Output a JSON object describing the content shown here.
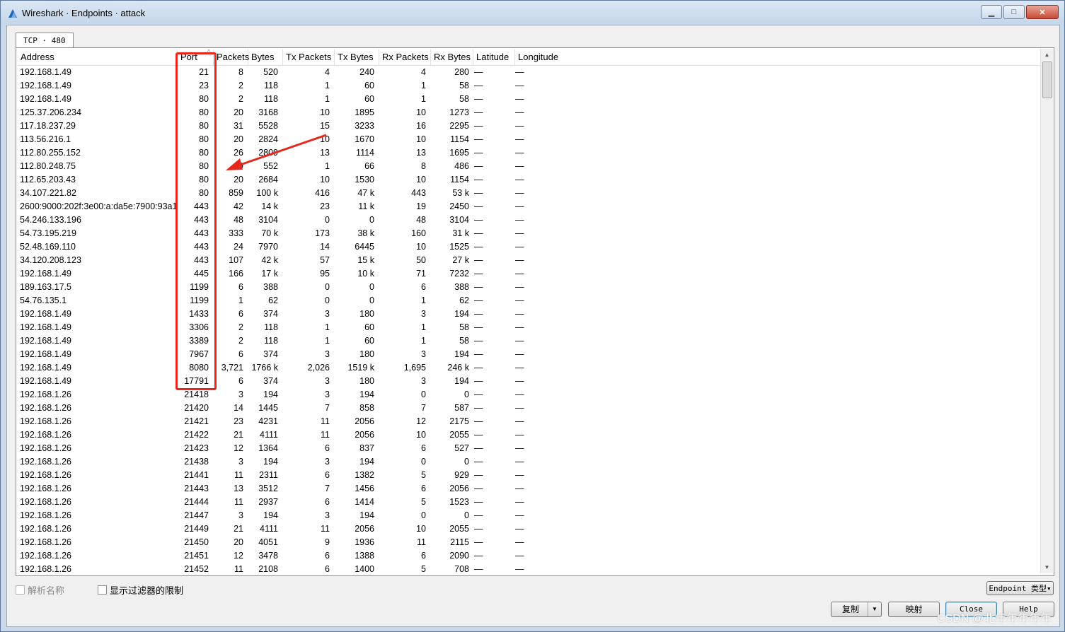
{
  "window": {
    "title": "Wireshark · Endpoints · attack",
    "minimize_glyph": "▁",
    "maximize_glyph": "□",
    "close_glyph": "✕"
  },
  "tab": {
    "label": "TCP · 480"
  },
  "columns": [
    "Address",
    "Port",
    "Packets",
    "Bytes",
    "Tx Packets",
    "Tx Bytes",
    "Rx Packets",
    "Rx Bytes",
    "Latitude",
    "Longitude"
  ],
  "rows": [
    [
      "192.168.1.49",
      "21",
      "8",
      "520",
      "4",
      "240",
      "4",
      "280",
      "—",
      "—"
    ],
    [
      "192.168.1.49",
      "23",
      "2",
      "118",
      "1",
      "60",
      "1",
      "58",
      "—",
      "—"
    ],
    [
      "192.168.1.49",
      "80",
      "2",
      "118",
      "1",
      "60",
      "1",
      "58",
      "—",
      "—"
    ],
    [
      "125.37.206.234",
      "80",
      "20",
      "3168",
      "10",
      "1895",
      "10",
      "1273",
      "—",
      "—"
    ],
    [
      "117.18.237.29",
      "80",
      "31",
      "5528",
      "15",
      "3233",
      "16",
      "2295",
      "—",
      "—"
    ],
    [
      "113.56.216.1",
      "80",
      "20",
      "2824",
      "10",
      "1670",
      "10",
      "1154",
      "—",
      "—"
    ],
    [
      "112.80.255.152",
      "80",
      "26",
      "2809",
      "13",
      "1114",
      "13",
      "1695",
      "—",
      "—"
    ],
    [
      "112.80.248.75",
      "80",
      "9",
      "552",
      "1",
      "66",
      "8",
      "486",
      "—",
      "—"
    ],
    [
      "112.65.203.43",
      "80",
      "20",
      "2684",
      "10",
      "1530",
      "10",
      "1154",
      "—",
      "—"
    ],
    [
      "34.107.221.82",
      "80",
      "859",
      "100 k",
      "416",
      "47 k",
      "443",
      "53 k",
      "—",
      "—"
    ],
    [
      "2600:9000:202f:3e00:a:da5e:7900:93a1",
      "443",
      "42",
      "14 k",
      "23",
      "11 k",
      "19",
      "2450",
      "—",
      "—"
    ],
    [
      "54.246.133.196",
      "443",
      "48",
      "3104",
      "0",
      "0",
      "48",
      "3104",
      "—",
      "—"
    ],
    [
      "54.73.195.219",
      "443",
      "333",
      "70 k",
      "173",
      "38 k",
      "160",
      "31 k",
      "—",
      "—"
    ],
    [
      "52.48.169.110",
      "443",
      "24",
      "7970",
      "14",
      "6445",
      "10",
      "1525",
      "—",
      "—"
    ],
    [
      "34.120.208.123",
      "443",
      "107",
      "42 k",
      "57",
      "15 k",
      "50",
      "27 k",
      "—",
      "—"
    ],
    [
      "192.168.1.49",
      "445",
      "166",
      "17 k",
      "95",
      "10 k",
      "71",
      "7232",
      "—",
      "—"
    ],
    [
      "189.163.17.5",
      "1199",
      "6",
      "388",
      "0",
      "0",
      "6",
      "388",
      "—",
      "—"
    ],
    [
      "54.76.135.1",
      "1199",
      "1",
      "62",
      "0",
      "0",
      "1",
      "62",
      "—",
      "—"
    ],
    [
      "192.168.1.49",
      "1433",
      "6",
      "374",
      "3",
      "180",
      "3",
      "194",
      "—",
      "—"
    ],
    [
      "192.168.1.49",
      "3306",
      "2",
      "118",
      "1",
      "60",
      "1",
      "58",
      "—",
      "—"
    ],
    [
      "192.168.1.49",
      "3389",
      "2",
      "118",
      "1",
      "60",
      "1",
      "58",
      "—",
      "—"
    ],
    [
      "192.168.1.49",
      "7967",
      "6",
      "374",
      "3",
      "180",
      "3",
      "194",
      "—",
      "—"
    ],
    [
      "192.168.1.49",
      "8080",
      "3,721",
      "1766 k",
      "2,026",
      "1519 k",
      "1,695",
      "246 k",
      "—",
      "—"
    ],
    [
      "192.168.1.49",
      "17791",
      "6",
      "374",
      "3",
      "180",
      "3",
      "194",
      "—",
      "—"
    ],
    [
      "192.168.1.26",
      "21418",
      "3",
      "194",
      "3",
      "194",
      "0",
      "0",
      "—",
      "—"
    ],
    [
      "192.168.1.26",
      "21420",
      "14",
      "1445",
      "7",
      "858",
      "7",
      "587",
      "—",
      "—"
    ],
    [
      "192.168.1.26",
      "21421",
      "23",
      "4231",
      "11",
      "2056",
      "12",
      "2175",
      "—",
      "—"
    ],
    [
      "192.168.1.26",
      "21422",
      "21",
      "4111",
      "11",
      "2056",
      "10",
      "2055",
      "—",
      "—"
    ],
    [
      "192.168.1.26",
      "21423",
      "12",
      "1364",
      "6",
      "837",
      "6",
      "527",
      "—",
      "—"
    ],
    [
      "192.168.1.26",
      "21438",
      "3",
      "194",
      "3",
      "194",
      "0",
      "0",
      "—",
      "—"
    ],
    [
      "192.168.1.26",
      "21441",
      "11",
      "2311",
      "6",
      "1382",
      "5",
      "929",
      "—",
      "—"
    ],
    [
      "192.168.1.26",
      "21443",
      "13",
      "3512",
      "7",
      "1456",
      "6",
      "2056",
      "—",
      "—"
    ],
    [
      "192.168.1.26",
      "21444",
      "11",
      "2937",
      "6",
      "1414",
      "5",
      "1523",
      "—",
      "—"
    ],
    [
      "192.168.1.26",
      "21447",
      "3",
      "194",
      "3",
      "194",
      "0",
      "0",
      "—",
      "—"
    ],
    [
      "192.168.1.26",
      "21449",
      "21",
      "4111",
      "11",
      "2056",
      "10",
      "2055",
      "—",
      "—"
    ],
    [
      "192.168.1.26",
      "21450",
      "20",
      "4051",
      "9",
      "1936",
      "11",
      "2115",
      "—",
      "—"
    ],
    [
      "192.168.1.26",
      "21451",
      "12",
      "3478",
      "6",
      "1388",
      "6",
      "2090",
      "—",
      "—"
    ],
    [
      "192.168.1.26",
      "21452",
      "11",
      "2108",
      "6",
      "1400",
      "5",
      "708",
      "—",
      "—"
    ]
  ],
  "options": {
    "resolve_names": "解析名称",
    "limit_to_filter": "显示过滤器的限制"
  },
  "buttons": {
    "endpoint_type": "Endpoint 类型",
    "copy": "复制",
    "map": "映射",
    "close": "Close",
    "help": "Help"
  },
  "watermark": "CSDN @北年年年年年",
  "colors": {
    "highlight": "#e8271c",
    "window_frame": "#c9d9ea"
  }
}
